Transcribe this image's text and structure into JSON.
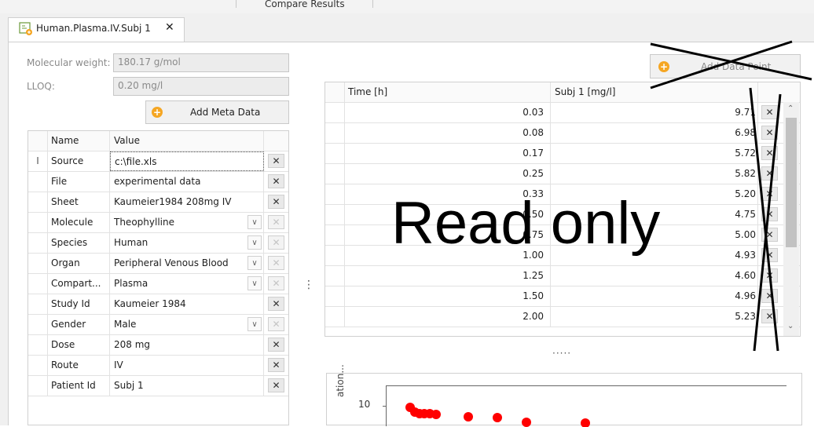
{
  "top_toolbar": {
    "compare_results_label": "Compare Results"
  },
  "document_tab": {
    "label": "Human.Plasma.IV.Subj 1",
    "close_glyph": "✕",
    "icon": "sheet-plot-icon"
  },
  "meta_fields": {
    "molecular_weight_label": "Molecular weight:",
    "molecular_weight_value": "180.17 g/mol",
    "lloq_label": "LLOQ:",
    "lloq_value": "0.20 mg/l"
  },
  "add_meta_data_button": {
    "label": "Add Meta Data"
  },
  "meta_table": {
    "columns": [
      "Name",
      "Value"
    ],
    "rows": [
      {
        "indicator": "I",
        "name": "Source",
        "value": "c:\\file.xls",
        "dropdown": false,
        "removable": true
      },
      {
        "indicator": "",
        "name": "File",
        "value": "experimental data",
        "dropdown": false,
        "removable": true
      },
      {
        "indicator": "",
        "name": "Sheet",
        "value": "Kaumeier1984 208mg IV",
        "dropdown": false,
        "removable": true
      },
      {
        "indicator": "",
        "name": "Molecule",
        "value": "Theophylline",
        "dropdown": true,
        "removable": false
      },
      {
        "indicator": "",
        "name": "Species",
        "value": "Human",
        "dropdown": true,
        "removable": false
      },
      {
        "indicator": "",
        "name": "Organ",
        "value": "Peripheral Venous Blood",
        "dropdown": true,
        "removable": false
      },
      {
        "indicator": "",
        "name": "Compart...",
        "value": "Plasma",
        "dropdown": true,
        "removable": false
      },
      {
        "indicator": "",
        "name": "Study Id",
        "value": "Kaumeier 1984",
        "dropdown": false,
        "removable": true
      },
      {
        "indicator": "",
        "name": "Gender",
        "value": "Male",
        "dropdown": true,
        "removable": false
      },
      {
        "indicator": "",
        "name": "Dose",
        "value": "208 mg",
        "dropdown": false,
        "removable": true
      },
      {
        "indicator": "",
        "name": "Route",
        "value": "IV",
        "dropdown": false,
        "removable": true
      },
      {
        "indicator": "",
        "name": "Patient Id",
        "value": "Subj 1",
        "dropdown": false,
        "removable": true
      }
    ]
  },
  "splitter_vertical_glyph": "⋮",
  "splitter_horizontal_glyph": "·····",
  "add_data_point_button": {
    "label": "Add Data Point"
  },
  "data_table": {
    "columns": [
      "Time  [h]",
      "Subj 1  [mg/l]"
    ],
    "rows": [
      {
        "time": "0.03",
        "value": "9.71"
      },
      {
        "time": "0.08",
        "value": "6.98"
      },
      {
        "time": "0.17",
        "value": "5.72"
      },
      {
        "time": "0.25",
        "value": "5.82"
      },
      {
        "time": "0.33",
        "value": "5.20"
      },
      {
        "time": "0.50",
        "value": "4.75"
      },
      {
        "time": "0.75",
        "value": "5.00"
      },
      {
        "time": "1.00",
        "value": "4.93"
      },
      {
        "time": "1.25",
        "value": "4.60"
      },
      {
        "time": "1.50",
        "value": "4.96"
      },
      {
        "time": "2.00",
        "value": "5.23"
      }
    ]
  },
  "overlay": {
    "read_only_label": "Read only",
    "annotation_color": "#000000"
  },
  "chart": {
    "y_label": "ation...",
    "y_tick": "10",
    "marker_color": "#ff0000"
  },
  "colors": {
    "accent_orange": "#f5a623",
    "tab_bg": "#f0f0f0"
  }
}
